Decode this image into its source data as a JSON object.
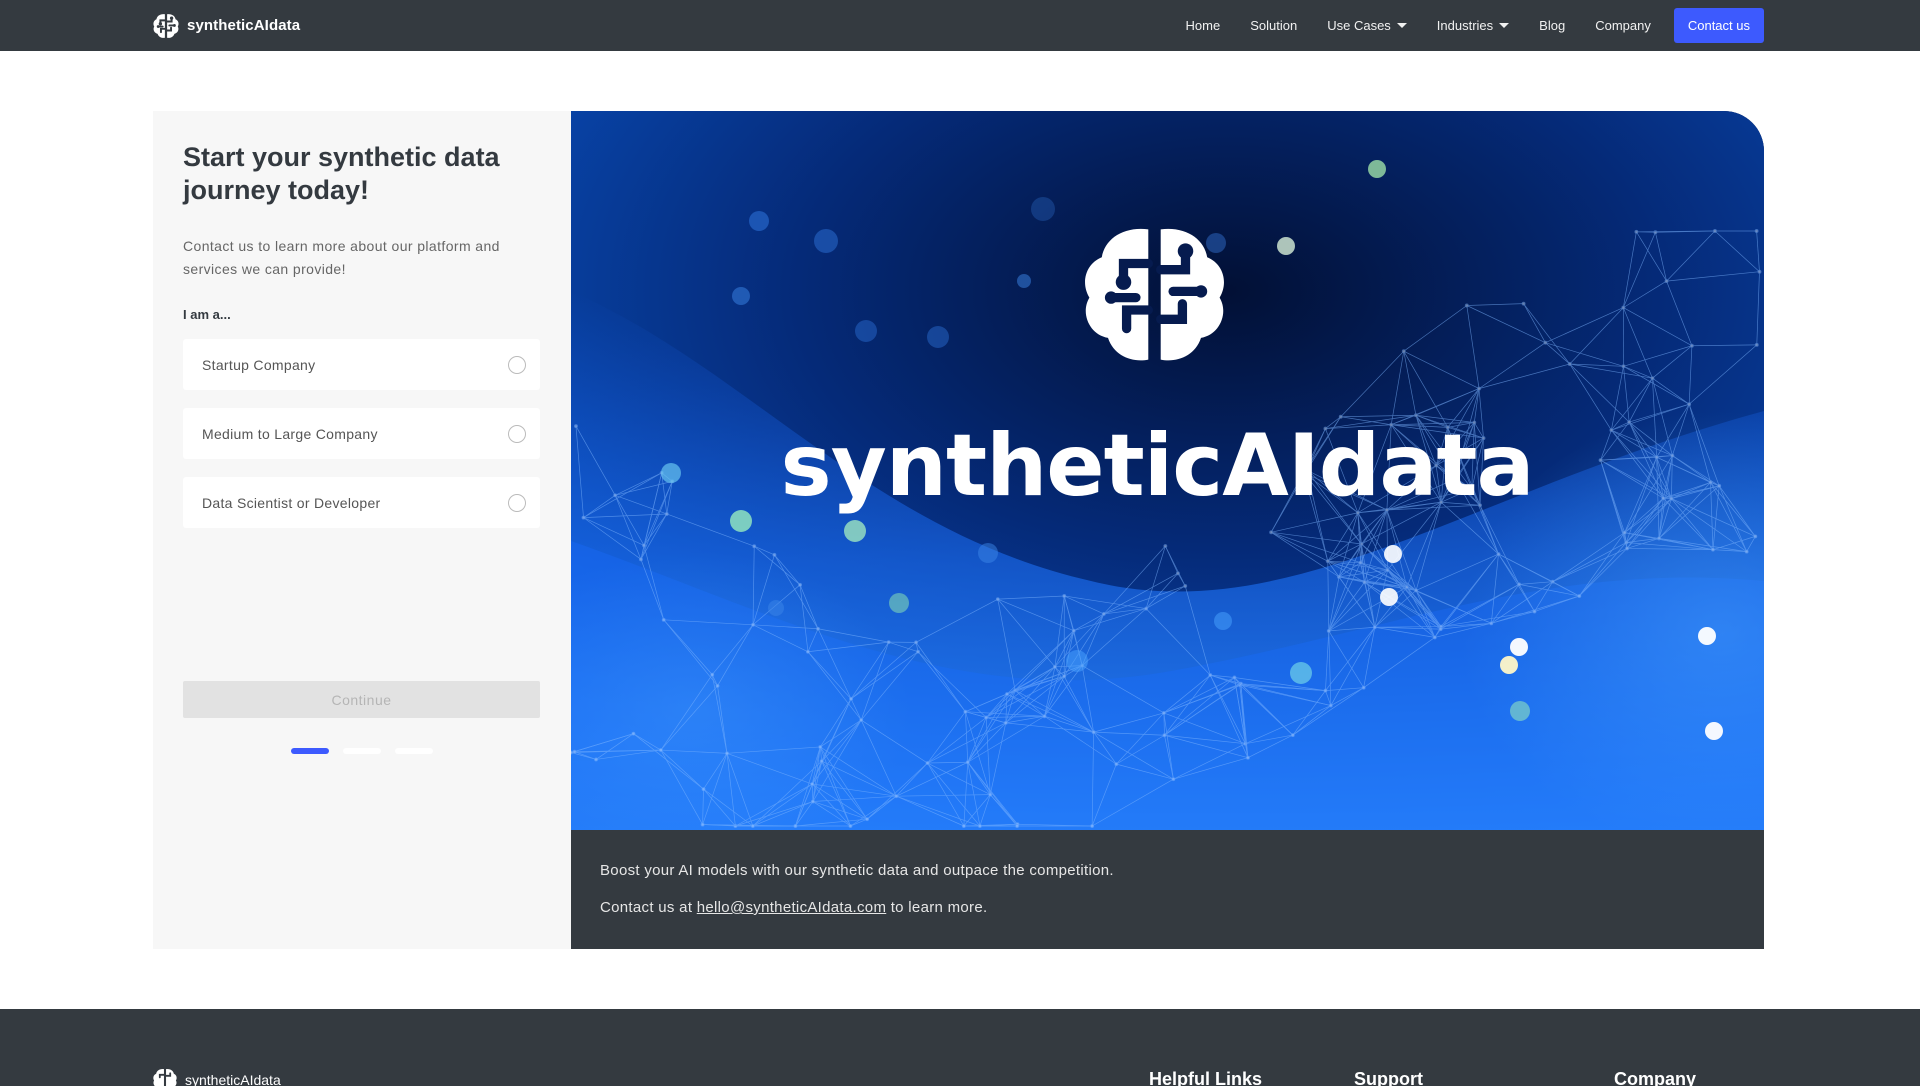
{
  "navbar": {
    "brand_name": "syntheticAIdata",
    "brand_icon": "brain-circuit-icon",
    "links": [
      {
        "label": "Home"
      },
      {
        "label": "Solution"
      },
      {
        "label": "Use Cases"
      },
      {
        "label": "Industries"
      },
      {
        "label": "Blog"
      },
      {
        "label": "Company"
      }
    ],
    "contact_button": "Contact us"
  },
  "form": {
    "title": "Start your synthetic data journey today!",
    "subtitle": "Contact us to learn more about our platform and services we can provide!",
    "question": "I am a...",
    "options": [
      {
        "label": "Startup Company",
        "selected": false
      },
      {
        "label": "Medium to Large Company",
        "selected": false
      },
      {
        "label": "Data Scientist or Developer",
        "selected": false
      }
    ],
    "continue_label": "Continue",
    "steps": {
      "total": 3,
      "current": 1
    }
  },
  "hero": {
    "brand_name": "syntheticAIdata",
    "caption_line1": "Boost your AI models with our synthetic data and outpace the competition.",
    "caption_prefix": "Contact us at ",
    "email": "hello@syntheticAIdata.com",
    "caption_suffix": " to learn more."
  },
  "footer": {
    "brand_name": "syntheticAIdata",
    "columns": [
      "Helpful Links",
      "Support",
      "Company"
    ]
  },
  "colors": {
    "navbar_bg": "#343a40",
    "accent": "#3d5afe",
    "panel_bg": "#f7f7f7"
  }
}
